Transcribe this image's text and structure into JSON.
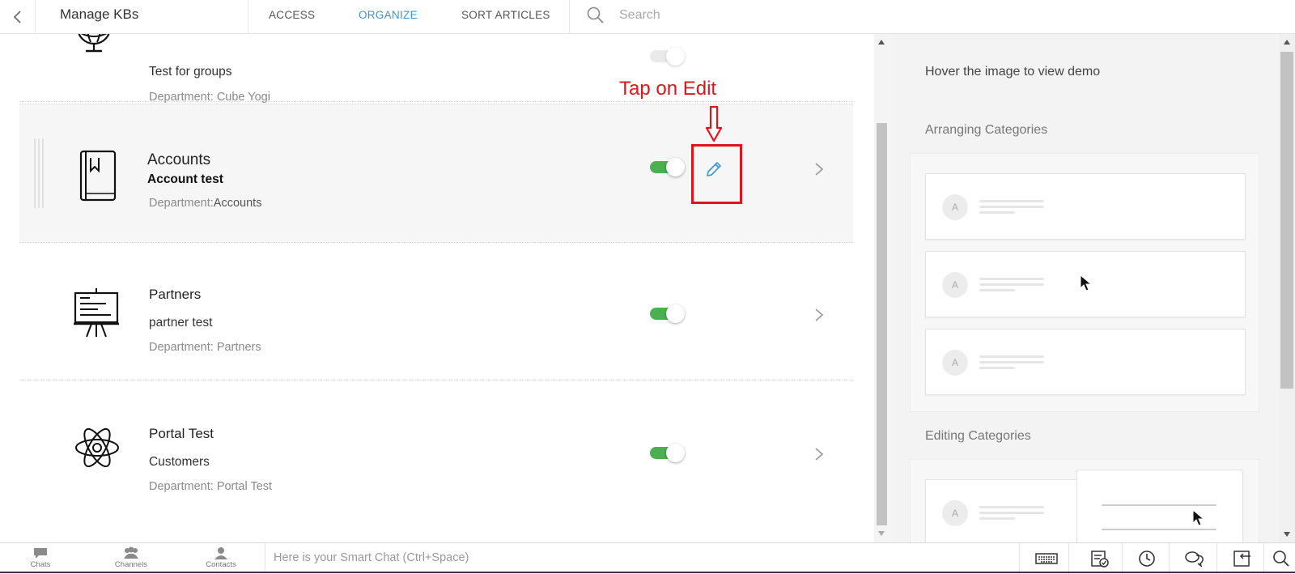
{
  "header": {
    "title": "Manage KBs",
    "tabs": [
      {
        "label": "ACCESS"
      },
      {
        "label": "ORGANIZE"
      },
      {
        "label": "SORT ARTICLES"
      }
    ],
    "search_placeholder": "Search"
  },
  "kb_list": [
    {
      "name": "",
      "description": "Test for groups",
      "department": "Department: Cube Yogi",
      "icon": "globe-icon",
      "enabled": true
    },
    {
      "name": "Accounts",
      "description": "Account test",
      "department": "Department:",
      "department_value": "Accounts",
      "icon": "book-icon",
      "enabled": true
    },
    {
      "name": "Partners",
      "description": "partner test",
      "department": "Department: Partners",
      "icon": "presentation-board-icon",
      "enabled": true
    },
    {
      "name": "Portal Test",
      "description": "Customers",
      "department": "Department: Portal Test",
      "icon": "atom-icon",
      "enabled": true
    }
  ],
  "annotation": {
    "text": "Tap on Edit",
    "color": "#e0141c"
  },
  "right_panel": {
    "hint": "Hover the image to view demo",
    "sections": [
      {
        "title": "Arranging Categories",
        "avatar_letter": "A"
      },
      {
        "title": "Editing Categories",
        "avatar_letter": "A"
      }
    ]
  },
  "bottom_bar": {
    "nav": [
      {
        "label": "Chats",
        "icon": "chat-bubble-icon"
      },
      {
        "label": "Channels",
        "icon": "channels-icon"
      },
      {
        "label": "Contacts",
        "icon": "contact-icon"
      }
    ],
    "smart_chat_placeholder": "Here is your Smart Chat (Ctrl+Space)"
  },
  "colors": {
    "accent": "#3d95d6",
    "toggle_on": "#4caf50",
    "annotation": "#e0141c"
  }
}
